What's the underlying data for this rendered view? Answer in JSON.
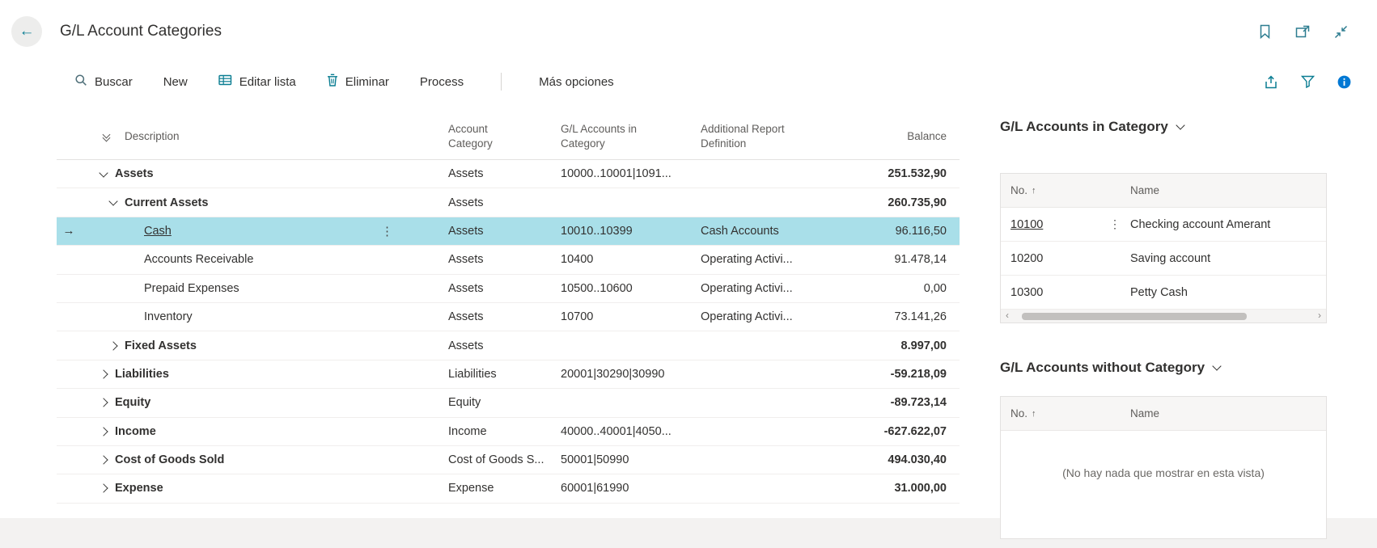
{
  "header": {
    "title": "G/L Account Categories"
  },
  "icons": {
    "back": "←",
    "ellipsis": "⋮",
    "current_row": "→",
    "sort_asc": "↑",
    "scroll_left": "‹",
    "scroll_right": "›"
  },
  "colors": {
    "accent_teal": "#0a7d92",
    "selected_row": "#a9dfe9",
    "info_blue": "#0078d4"
  },
  "action_bar": {
    "search": "Buscar",
    "new": "New",
    "edit_list": "Editar lista",
    "delete": "Eliminar",
    "process": "Process",
    "more_options": "Más opciones"
  },
  "main_table": {
    "columns": {
      "description": "Description",
      "account_category": "Account Category",
      "accounts_in_category": "G/L Accounts in Category",
      "additional_report_definition": "Additional Report Definition",
      "balance": "Balance"
    },
    "rows": [
      {
        "description": "Assets",
        "account_category": "Assets",
        "accounts": "10000..10001|1091...",
        "report_definition": "",
        "balance": "251.532,90"
      },
      {
        "description": "Current Assets",
        "account_category": "Assets",
        "accounts": "",
        "report_definition": "",
        "balance": "260.735,90"
      },
      {
        "description": "Cash",
        "account_category": "Assets",
        "accounts": "10010..10399",
        "report_definition": "Cash Accounts",
        "balance": "96.116,50"
      },
      {
        "description": "Accounts Receivable",
        "account_category": "Assets",
        "accounts": "10400",
        "report_definition": "Operating Activi...",
        "balance": "91.478,14"
      },
      {
        "description": "Prepaid Expenses",
        "account_category": "Assets",
        "accounts": "10500..10600",
        "report_definition": "Operating Activi...",
        "balance": "0,00"
      },
      {
        "description": "Inventory",
        "account_category": "Assets",
        "accounts": "10700",
        "report_definition": "Operating Activi...",
        "balance": "73.141,26"
      },
      {
        "description": "Fixed Assets",
        "account_category": "Assets",
        "accounts": "",
        "report_definition": "",
        "balance": "8.997,00"
      },
      {
        "description": "Liabilities",
        "account_category": "Liabilities",
        "accounts": "20001|30290|30990",
        "report_definition": "",
        "balance": "-59.218,09"
      },
      {
        "description": "Equity",
        "account_category": "Equity",
        "accounts": "",
        "report_definition": "",
        "balance": "-89.723,14"
      },
      {
        "description": "Income",
        "account_category": "Income",
        "accounts": "40000..40001|4050...",
        "report_definition": "",
        "balance": "-627.622,07"
      },
      {
        "description": "Cost of Goods Sold",
        "account_category": "Cost of Goods S...",
        "accounts": "50001|50990",
        "report_definition": "",
        "balance": "494.030,40"
      },
      {
        "description": "Expense",
        "account_category": "Expense",
        "accounts": "60001|61990",
        "report_definition": "",
        "balance": "31.000,00"
      }
    ]
  },
  "factbox": {
    "in_category": {
      "title": "G/L Accounts in Category",
      "columns": {
        "no": "No.",
        "name": "Name"
      },
      "rows": [
        {
          "no": "10100",
          "name": "Checking account Amerant"
        },
        {
          "no": "10200",
          "name": "Saving account"
        },
        {
          "no": "10300",
          "name": "Petty Cash"
        }
      ]
    },
    "without_category": {
      "title": "G/L Accounts without Category",
      "columns": {
        "no": "No.",
        "name": "Name"
      },
      "empty_message": "(No hay nada que mostrar en esta vista)"
    }
  }
}
